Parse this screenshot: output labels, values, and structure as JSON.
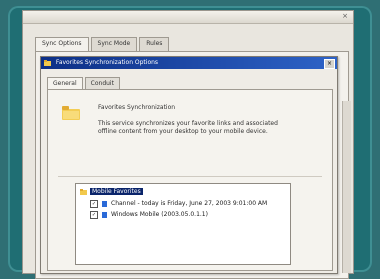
{
  "outer_window": {
    "close_glyph": "×",
    "tabs": [
      {
        "label": "Sync Options"
      },
      {
        "label": "Sync Mode"
      },
      {
        "label": "Rules"
      }
    ]
  },
  "dialog": {
    "title": "Favorites Synchronization Options",
    "close_glyph": "×",
    "tabs": [
      {
        "label": "General"
      },
      {
        "label": "Conduit"
      }
    ],
    "feature_name": "Favorites Synchronization",
    "description": "This service synchronizes your favorite links and associated offline content from your desktop to your mobile device.",
    "tree": {
      "root_label": "Mobile Favorites",
      "items": [
        {
          "label": "Channel - today is Friday, June 27, 2003 9:01:00 AM"
        },
        {
          "label": "Windows Mobile (2003.05.0.1.1)"
        }
      ]
    }
  },
  "colors": {
    "title_bar_start": "#0c2f86",
    "title_bar_end": "#2e63c7",
    "frame": "#1f6e73"
  },
  "icons": {
    "folder": "folder-icon",
    "page": "page-icon"
  }
}
